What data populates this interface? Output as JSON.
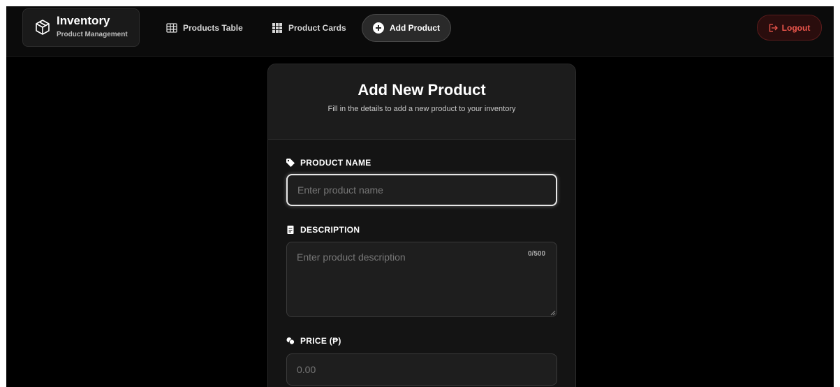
{
  "brand": {
    "title": "Inventory",
    "subtitle": "Product Management",
    "icon": "box-icon"
  },
  "nav": {
    "products_table": "Products Table",
    "product_cards": "Product Cards",
    "add_product": "Add Product",
    "active": "add_product"
  },
  "logout_label": "Logout",
  "form": {
    "title": "Add New Product",
    "subtitle": "Fill in the details to add a new product to your inventory",
    "name": {
      "label": "PRODUCT NAME",
      "placeholder": "Enter product name",
      "value": ""
    },
    "description": {
      "label": "DESCRIPTION",
      "placeholder": "Enter product description",
      "value": "",
      "counter": "0/500"
    },
    "price": {
      "label": "PRICE (₱)",
      "placeholder": "0.00",
      "value": ""
    }
  },
  "colors": {
    "background": "#000000",
    "logout": "#f0574d"
  }
}
